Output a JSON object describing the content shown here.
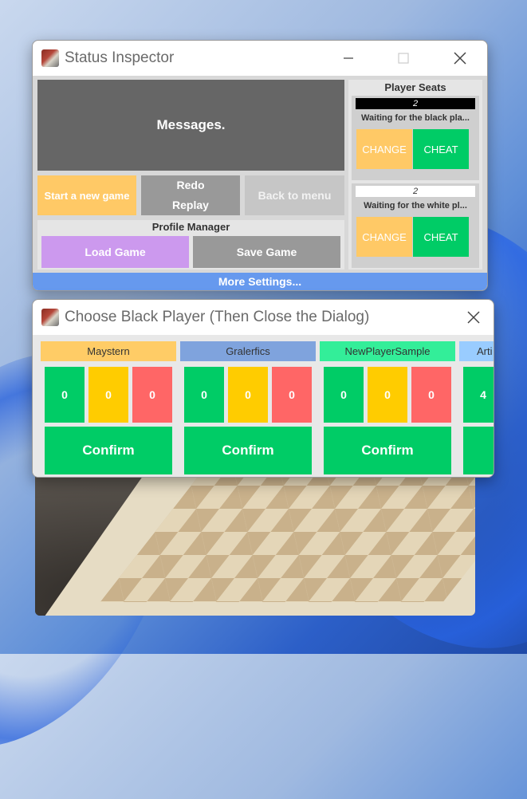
{
  "status_window": {
    "title": "Status Inspector",
    "messages": "Messages.",
    "start_label": "Start a new game",
    "redo_label": "Redo",
    "replay_label": "Replay",
    "back_label": "Back to menu",
    "profile_title": "Profile Manager",
    "load_label": "Load Game",
    "save_label": "Save Game",
    "seats_title": "Player Seats",
    "black_seat": {
      "count": "2",
      "status": "Waiting for the black pla...",
      "change_label": "CHANGE",
      "cheat_label": "CHEAT"
    },
    "white_seat": {
      "count": "2",
      "status": "Waiting for the white pl...",
      "change_label": "CHANGE",
      "cheat_label": "CHEAT"
    },
    "more_label": "More Settings..."
  },
  "choose_dialog": {
    "title": "Choose Black Player (Then Close the Dialog)",
    "players": [
      {
        "name": "Maystern",
        "stats": [
          "0",
          "0",
          "0"
        ],
        "confirm": "Confirm",
        "color": "#ffcc66"
      },
      {
        "name": "Gralerfics",
        "stats": [
          "0",
          "0",
          "0"
        ],
        "confirm": "Confirm",
        "color": "#7fa3dd"
      },
      {
        "name": "NewPlayerSample",
        "stats": [
          "0",
          "0",
          "0"
        ],
        "confirm": "Confirm",
        "color": "#33ee99"
      },
      {
        "name": "Arti",
        "stats": [
          "4",
          "",
          ""
        ],
        "confirm": "",
        "color": "#99ccff"
      }
    ]
  },
  "colors": {
    "accent_blue": "#6699ee",
    "stat_green": "#00cc66",
    "stat_yellow": "#ffcc00",
    "stat_red": "#ff6666",
    "change_orange": "#ffc966",
    "load_purple": "#cc99ee"
  }
}
